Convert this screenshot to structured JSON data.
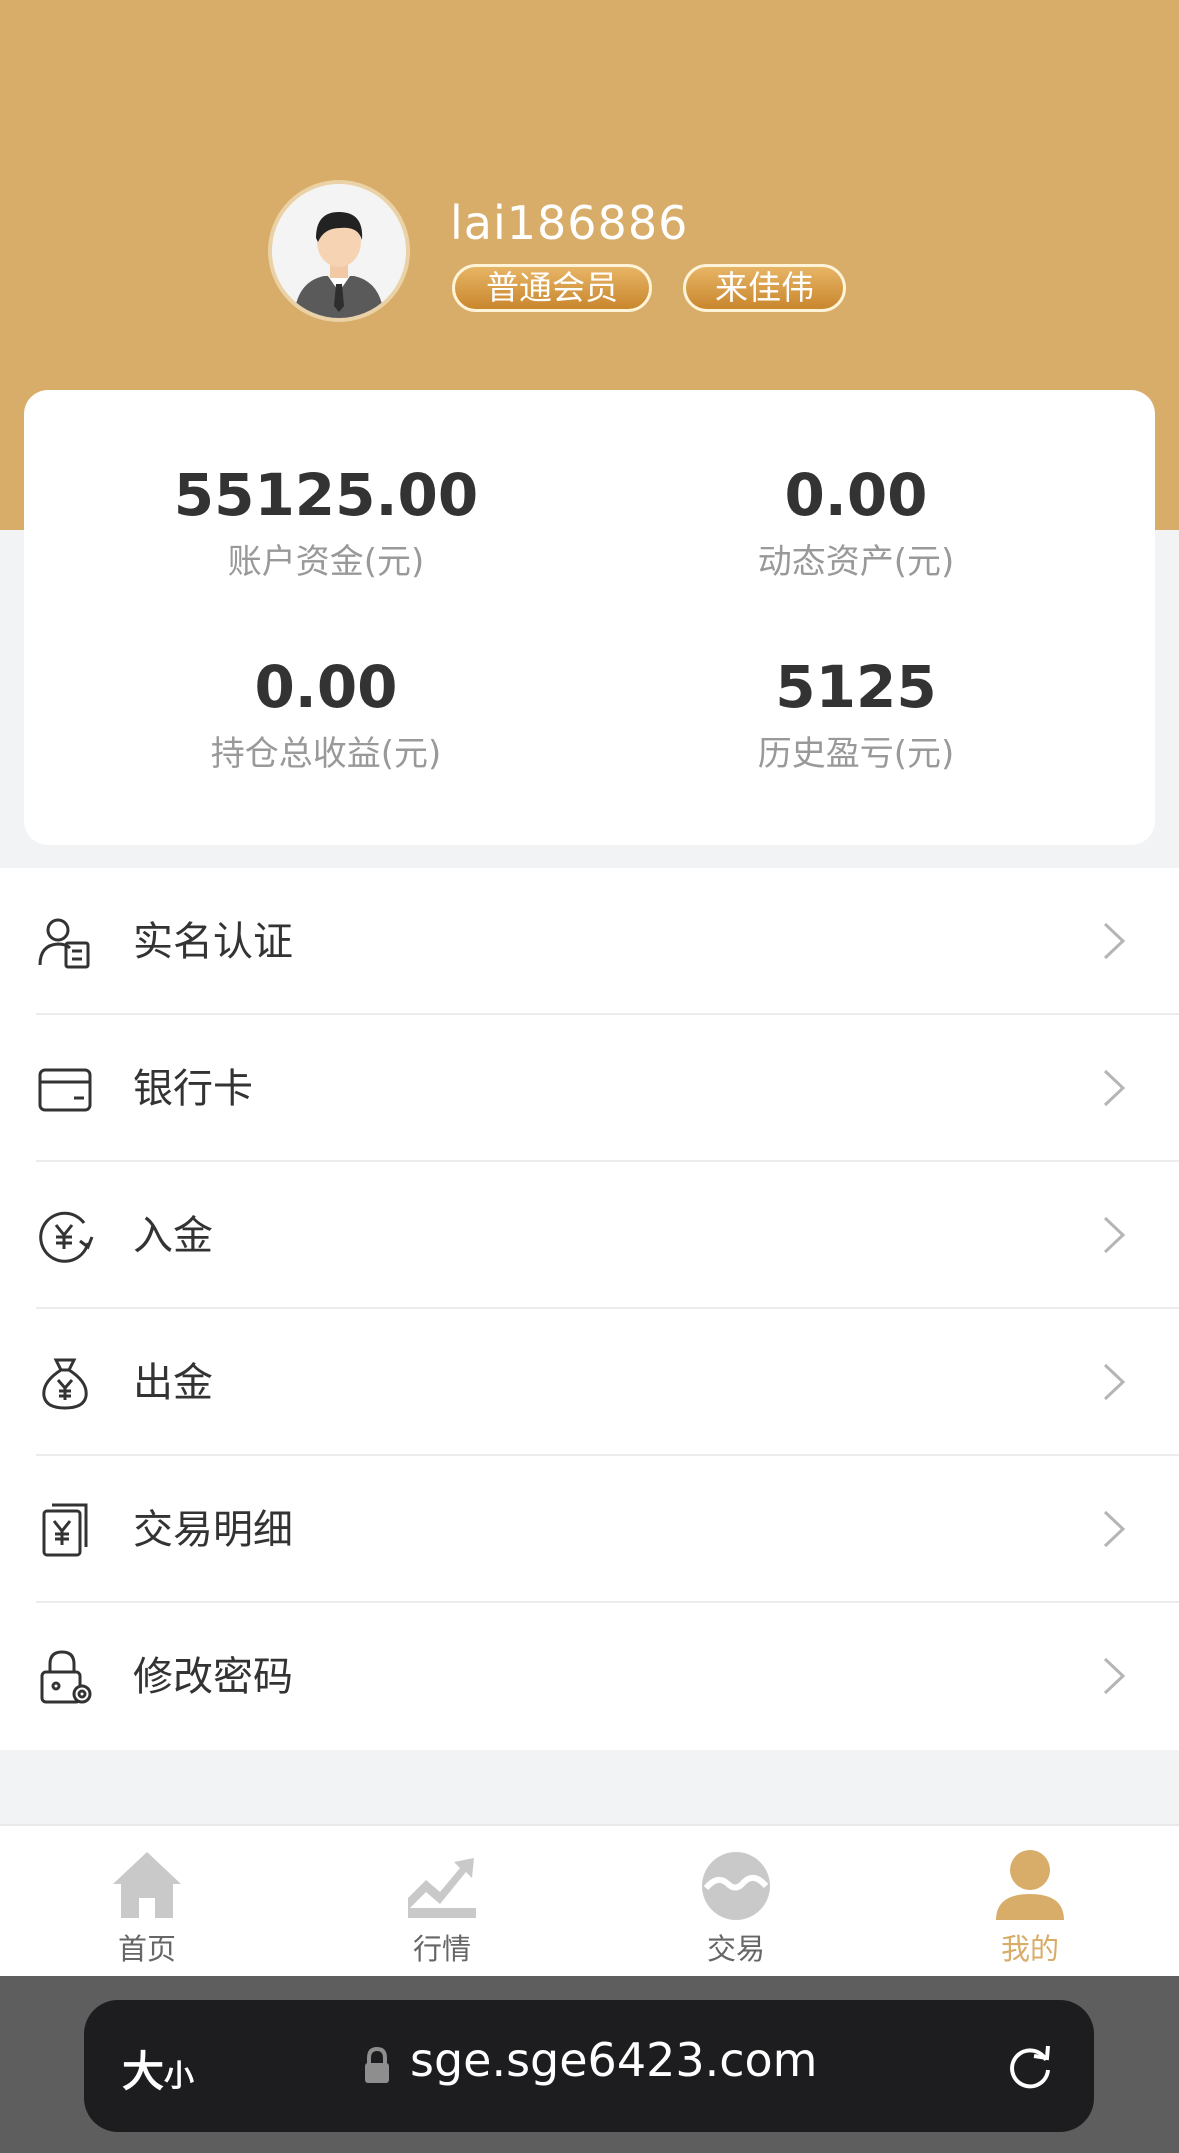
{
  "profile": {
    "username": "lai186886",
    "badges": [
      "普通会员",
      "来佳伟"
    ]
  },
  "stats": [
    {
      "value": "55125.00",
      "label": "账户资金(元)"
    },
    {
      "value": "0.00",
      "label": "动态资产(元)"
    },
    {
      "value": "0.00",
      "label": "持仓总收益(元)"
    },
    {
      "value": "5125",
      "label": "历史盈亏(元)"
    }
  ],
  "menu": [
    {
      "label": "实名认证",
      "icon": "id-verify-icon"
    },
    {
      "label": "银行卡",
      "icon": "bank-card-icon"
    },
    {
      "label": "入金",
      "icon": "deposit-icon"
    },
    {
      "label": "出金",
      "icon": "withdraw-money-bag-icon"
    },
    {
      "label": "交易明细",
      "icon": "transaction-details-icon"
    },
    {
      "label": "修改密码",
      "icon": "lock-settings-icon"
    }
  ],
  "tabs": [
    {
      "label": "首页",
      "icon": "home-icon"
    },
    {
      "label": "行情",
      "icon": "market-chart-icon"
    },
    {
      "label": "交易",
      "icon": "trade-icon"
    },
    {
      "label": "我的",
      "icon": "profile-icon",
      "active": true
    }
  ],
  "browser": {
    "text_size_label": "大",
    "text_size_small": "小",
    "url": "sge.sge6423.com"
  },
  "colors": {
    "header": "#d8ac69",
    "accent": "#d8ac69",
    "badge": "#c9862d"
  }
}
